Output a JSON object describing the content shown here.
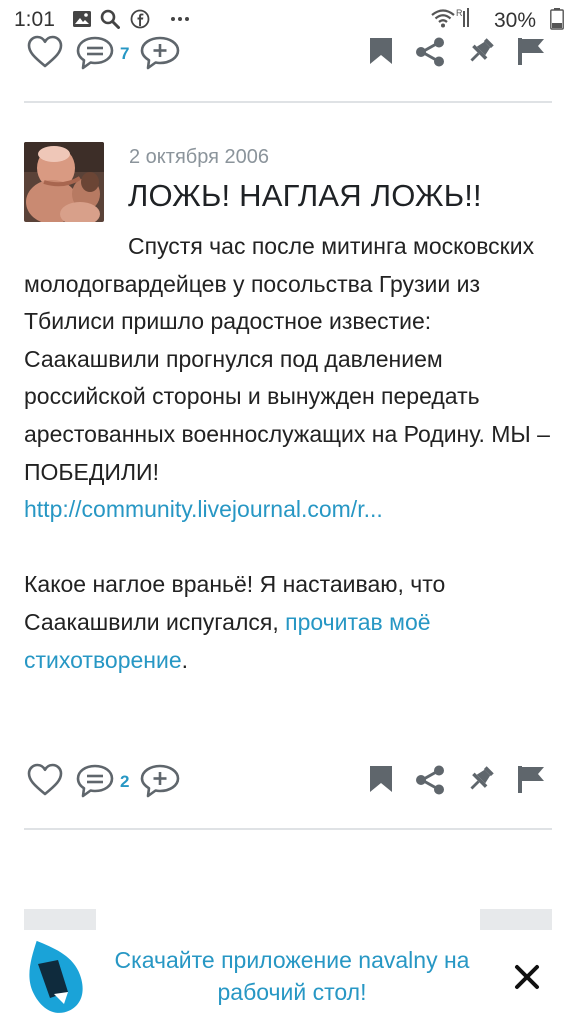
{
  "status_bar": {
    "time": "1:01",
    "battery_percent": "30%",
    "icons": [
      "image-icon",
      "search-icon",
      "facebook-icon",
      "more-dots-icon",
      "wifi-icon",
      "signal-icon",
      "battery-icon"
    ]
  },
  "actions_top": {
    "comments_count": "7"
  },
  "post": {
    "date": "2 октября 2006",
    "title": "ЛОЖЬ! НАГЛАЯ ЛОЖЬ!!",
    "paragraph1": "Спустя час после митинга московских молодогвардейцев у посольства Грузии из Тбилиси пришло радостное известие: Саакашвили прогнулся под давлением российской стороны и вынужден передать арестованных военнослужащих на Родину. МЫ – ПОБЕДИЛИ!",
    "link_url": "http://community.livejournal.com/r...",
    "paragraph2_text": "Какое наглое враньё! Я настаиваю, что Саакашвили испугался, ",
    "paragraph2_link": "прочитав моё стихотворение",
    "paragraph2_end": "."
  },
  "actions_bottom": {
    "comments_count": "2"
  },
  "banner": {
    "text": "Скачайте приложение navalny на рабочий стол!",
    "close_symbol": "✕"
  },
  "colors": {
    "accent": "#2797c4",
    "icon_grey": "#5f666c",
    "date_grey": "#8b949b",
    "divider": "#dfe2e5"
  }
}
